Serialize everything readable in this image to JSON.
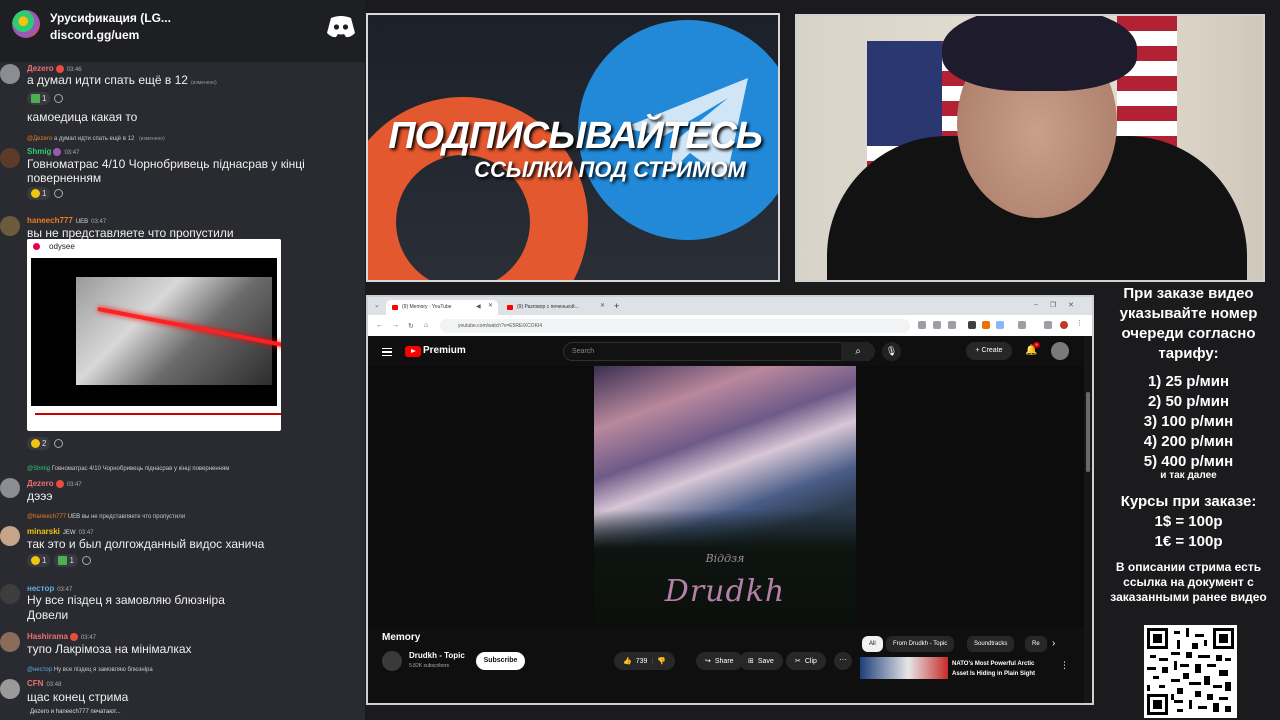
{
  "chat": {
    "server_name": "Урусификация (LG...",
    "server_invite": "discord.gg/uem",
    "messages": [
      {
        "user": "Дezero",
        "time": "03:46",
        "text": "а думал идти спать ещё в 12",
        "edited": "(изменено)",
        "react_count": "1",
        "text2": "камоедица какая то"
      },
      {
        "reply_user": "@Дezero",
        "reply_text": "а думал идти спать ещё в 12",
        "reply_edited": "(изменено)",
        "user": "Shmig",
        "time": "03:47",
        "text": "Говноматрас 4/10 Чорнобривець піднасрав у кінці поверненням",
        "react_count": "1"
      },
      {
        "user": "haneech777",
        "tag": "UEB",
        "time": "03:47",
        "text": "вы не представляете что пропустили",
        "embed_site": "odysee",
        "embed_caption": "X-men vs ruses",
        "react_count": "2"
      },
      {
        "reply_user": "@Shmig",
        "reply_text": "Говноматрас 4/10 Чорнобривець піднасрав у кінці поверненням",
        "user": "Дezero",
        "time": "03:47",
        "text": "дэээ"
      },
      {
        "reply_user": "@haneech777",
        "reply_tag": "UEB",
        "reply_text": "вы не представляете что пропустили",
        "user": "minarski",
        "tag": "JEW",
        "time": "03:47",
        "text": "так это и был долгожданный видос ханича",
        "react_count_a": "1",
        "react_count_b": "1"
      },
      {
        "user": "нестор",
        "time": "03:47",
        "text": "Ну все піздец я замовляю блюзніра",
        "text2": "Довели"
      },
      {
        "user": "Hashirama",
        "time": "03:47",
        "text": "тупо Лакрімоза на мінімалках"
      },
      {
        "reply_user": "@нестор",
        "reply_text": "Ну все піздец я замовляю блюзніра",
        "user": "CFN",
        "time": "03:48",
        "text": "щас конец стрима"
      }
    ],
    "typing": "Дezero и haneech777 печатают..."
  },
  "promo": {
    "line1": "ПОДПИСЫВАЙТЕСЬ",
    "line2": "ССЫЛКИ ПОД СТРИМОМ"
  },
  "browser": {
    "tabs": [
      {
        "label": "(9) Memory · YouTube"
      },
      {
        "label": "(9) Разговор с печенькой..."
      }
    ],
    "url": "youtube.com/watch?v=E5REIXCOKI4",
    "youtube": {
      "brand": "Premium",
      "search_placeholder": "Search",
      "create_label": "Create",
      "bell_count": "9",
      "video_title": "Memory",
      "channel_name": "Drudkh - Topic",
      "channel_subs": "5.82K subscribers",
      "subscribe_label": "Subscribe",
      "likes": "739",
      "share_label": "Share",
      "save_label": "Save",
      "clip_label": "Clip",
      "album_text": "Drudkh",
      "album_sub": "Віддзя",
      "chips": [
        "All",
        "From Drudkh - Topic",
        "Soundtracks",
        "Re"
      ],
      "rec_title": "NATO's Most Powerful Arctic Asset Is Hiding in Plain Sight"
    }
  },
  "info": {
    "head": "При заказе видео указывайте номер очереди согласно тарифу:",
    "tariffs": [
      "1) 25 р/мин",
      "2) 50 р/мин",
      "3) 100 р/мин",
      "4) 200 р/мин",
      "5) 400 р/мин"
    ],
    "etc": "и так далее",
    "courses_title": "Курсы при заказе:",
    "courses": [
      "1$ = 100р",
      "1€ = 100р"
    ],
    "desc": "В описании стрима есть ссылка на документ с заказанными ранее видео"
  },
  "colors": {
    "chat_bg": "#2a2b30",
    "discord_blurple": "#5865f2",
    "youtube_red": "#ff0000",
    "telegram_blue": "#2189d8",
    "promo_orange": "#e4582f"
  }
}
